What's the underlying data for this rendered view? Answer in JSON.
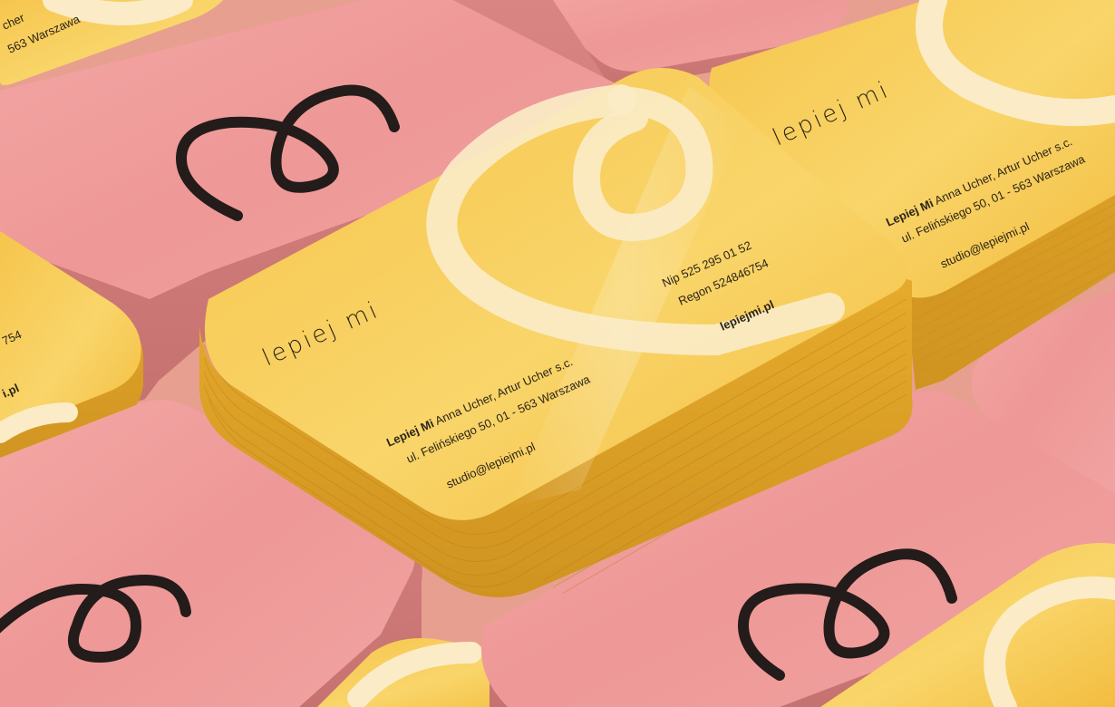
{
  "card_front": {
    "logo_text": "lepiej mi",
    "company_bold": "Lepiej Mi",
    "company_names": "Anna Ucher, Artur Ucher s.c.",
    "address": "ul. Felińskiego 50, 01 - 563 Warszawa",
    "email": "studio@lepiejmi.pl",
    "nip": "Nip 525 295 01 52",
    "regon": "Regon 524846754",
    "website": "lepiejmi.pl"
  },
  "card_right": {
    "logo_text": "lepiej mi",
    "company_bold": "Lepiej Mi",
    "company_names": "Anna Ucher, Artur Ucher s.c.",
    "address": "ul. Felińskiego 50, 01 - 563 Warszawa",
    "email": "studio@lepiejmi.pl"
  },
  "card_left_partial": {
    "regon_fragment": "754",
    "website_fragment": "i.pl"
  },
  "card_top_left_partial": {
    "company_fragment": "cher",
    "address_fragment": "563 Warszawa"
  },
  "colors": {
    "background": "#f0b6a0",
    "pink_card": "#ef9e9c",
    "yellow_card": "#f6c64e",
    "loop_cream": "#fbecc7",
    "ink": "#2b2418"
  }
}
